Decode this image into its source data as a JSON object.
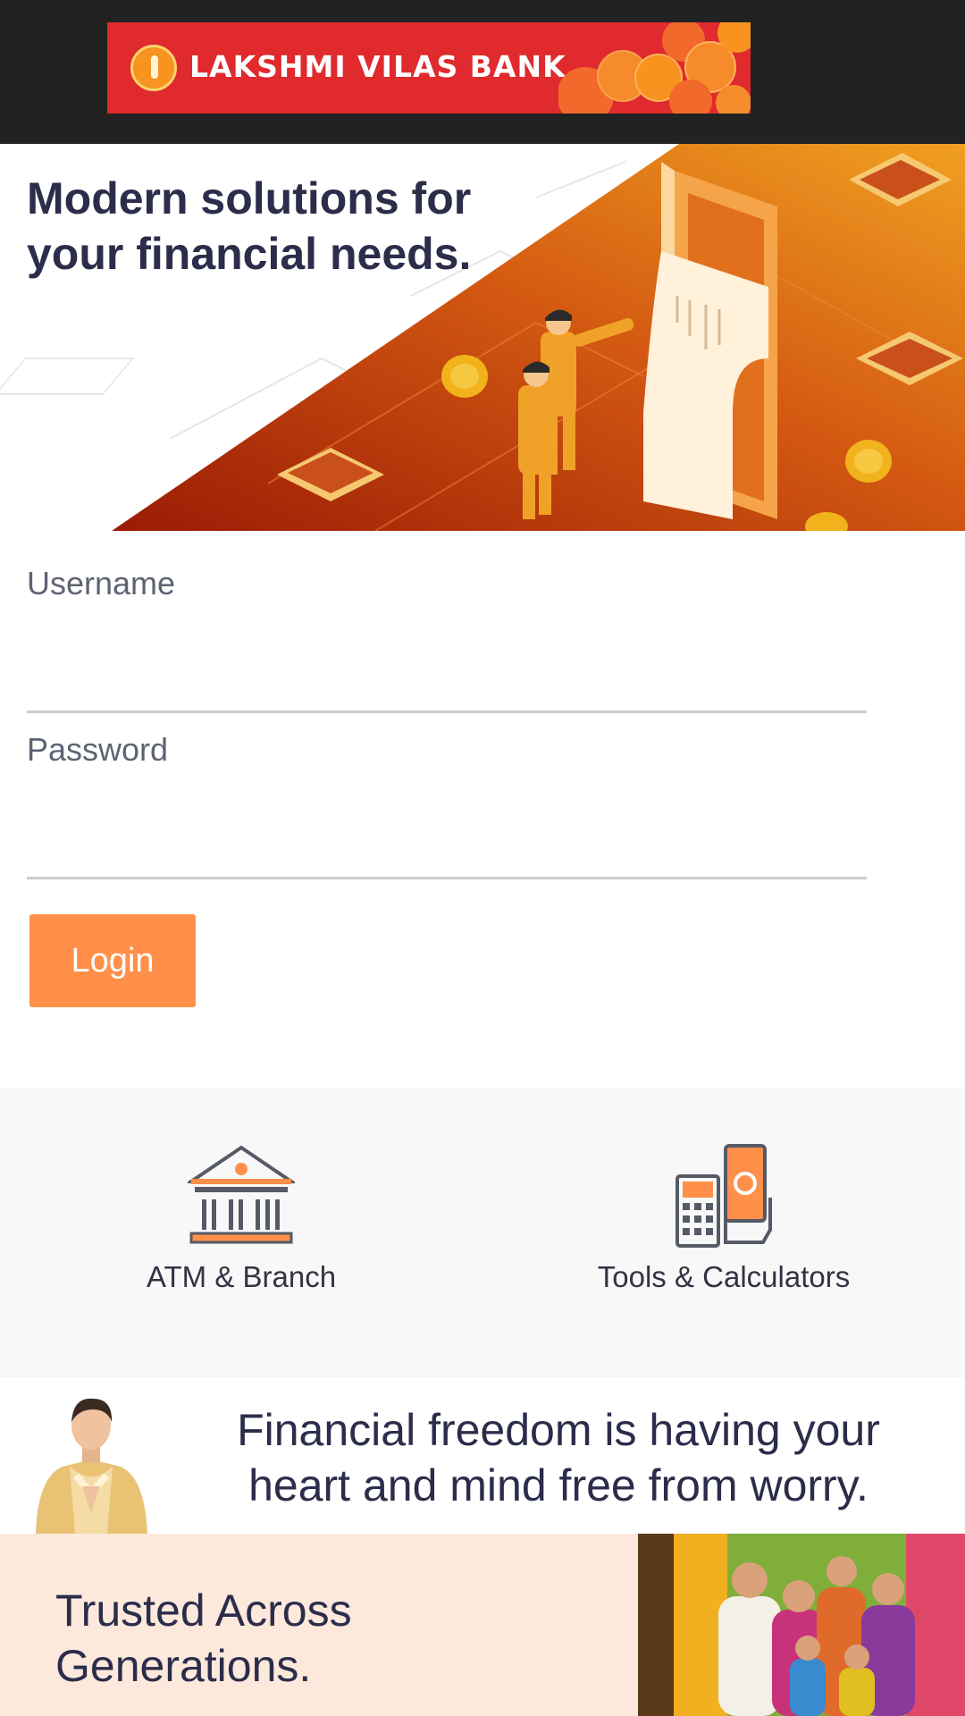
{
  "header": {
    "bank_name": "LAKSHMI VILAS BANK",
    "brand_red": "#e02a2e",
    "brand_orange": "#f7931e",
    "logo_icon": "lakshmi-emblem-icon"
  },
  "hero": {
    "title": "Modern solutions for your financial needs.",
    "illustration": "atm-receipt-illustration"
  },
  "login": {
    "username_label": "Username",
    "username_value": "",
    "password_label": "Password",
    "password_value": "",
    "login_label": "Login",
    "button_color": "#ff8f49"
  },
  "quick_links": [
    {
      "label": "ATM & Branch",
      "icon": "bank-building-icon"
    },
    {
      "label": "Tools & Calculators",
      "icon": "calculator-icon"
    }
  ],
  "freedom": {
    "text": "Financial freedom is having your heart and mind free from worry."
  },
  "trusted": {
    "text": "Trusted Across Generations."
  }
}
